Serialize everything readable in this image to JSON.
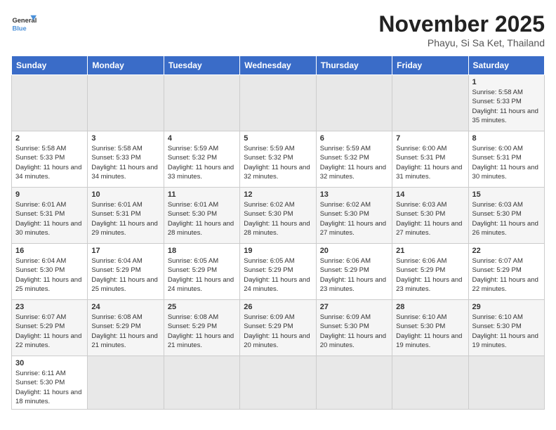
{
  "header": {
    "logo_general": "General",
    "logo_blue": "Blue",
    "month_title": "November 2025",
    "location": "Phayu, Si Sa Ket, Thailand"
  },
  "days_of_week": [
    "Sunday",
    "Monday",
    "Tuesday",
    "Wednesday",
    "Thursday",
    "Friday",
    "Saturday"
  ],
  "weeks": [
    [
      {
        "day": "",
        "empty": true
      },
      {
        "day": "",
        "empty": true
      },
      {
        "day": "",
        "empty": true
      },
      {
        "day": "",
        "empty": true
      },
      {
        "day": "",
        "empty": true
      },
      {
        "day": "",
        "empty": true
      },
      {
        "day": "1",
        "sunrise": "5:58 AM",
        "sunset": "5:33 PM",
        "daylight": "11 hours and 35 minutes."
      }
    ],
    [
      {
        "day": "2",
        "sunrise": "5:58 AM",
        "sunset": "5:33 PM",
        "daylight": "11 hours and 34 minutes."
      },
      {
        "day": "3",
        "sunrise": "5:58 AM",
        "sunset": "5:33 PM",
        "daylight": "11 hours and 34 minutes."
      },
      {
        "day": "4",
        "sunrise": "5:59 AM",
        "sunset": "5:32 PM",
        "daylight": "11 hours and 33 minutes."
      },
      {
        "day": "5",
        "sunrise": "5:59 AM",
        "sunset": "5:32 PM",
        "daylight": "11 hours and 32 minutes."
      },
      {
        "day": "6",
        "sunrise": "5:59 AM",
        "sunset": "5:32 PM",
        "daylight": "11 hours and 32 minutes."
      },
      {
        "day": "7",
        "sunrise": "6:00 AM",
        "sunset": "5:31 PM",
        "daylight": "11 hours and 31 minutes."
      },
      {
        "day": "8",
        "sunrise": "6:00 AM",
        "sunset": "5:31 PM",
        "daylight": "11 hours and 30 minutes."
      }
    ],
    [
      {
        "day": "9",
        "sunrise": "6:01 AM",
        "sunset": "5:31 PM",
        "daylight": "11 hours and 30 minutes."
      },
      {
        "day": "10",
        "sunrise": "6:01 AM",
        "sunset": "5:31 PM",
        "daylight": "11 hours and 29 minutes."
      },
      {
        "day": "11",
        "sunrise": "6:01 AM",
        "sunset": "5:30 PM",
        "daylight": "11 hours and 28 minutes."
      },
      {
        "day": "12",
        "sunrise": "6:02 AM",
        "sunset": "5:30 PM",
        "daylight": "11 hours and 28 minutes."
      },
      {
        "day": "13",
        "sunrise": "6:02 AM",
        "sunset": "5:30 PM",
        "daylight": "11 hours and 27 minutes."
      },
      {
        "day": "14",
        "sunrise": "6:03 AM",
        "sunset": "5:30 PM",
        "daylight": "11 hours and 27 minutes."
      },
      {
        "day": "15",
        "sunrise": "6:03 AM",
        "sunset": "5:30 PM",
        "daylight": "11 hours and 26 minutes."
      }
    ],
    [
      {
        "day": "16",
        "sunrise": "6:04 AM",
        "sunset": "5:30 PM",
        "daylight": "11 hours and 25 minutes."
      },
      {
        "day": "17",
        "sunrise": "6:04 AM",
        "sunset": "5:29 PM",
        "daylight": "11 hours and 25 minutes."
      },
      {
        "day": "18",
        "sunrise": "6:05 AM",
        "sunset": "5:29 PM",
        "daylight": "11 hours and 24 minutes."
      },
      {
        "day": "19",
        "sunrise": "6:05 AM",
        "sunset": "5:29 PM",
        "daylight": "11 hours and 24 minutes."
      },
      {
        "day": "20",
        "sunrise": "6:06 AM",
        "sunset": "5:29 PM",
        "daylight": "11 hours and 23 minutes."
      },
      {
        "day": "21",
        "sunrise": "6:06 AM",
        "sunset": "5:29 PM",
        "daylight": "11 hours and 23 minutes."
      },
      {
        "day": "22",
        "sunrise": "6:07 AM",
        "sunset": "5:29 PM",
        "daylight": "11 hours and 22 minutes."
      }
    ],
    [
      {
        "day": "23",
        "sunrise": "6:07 AM",
        "sunset": "5:29 PM",
        "daylight": "11 hours and 22 minutes."
      },
      {
        "day": "24",
        "sunrise": "6:08 AM",
        "sunset": "5:29 PM",
        "daylight": "11 hours and 21 minutes."
      },
      {
        "day": "25",
        "sunrise": "6:08 AM",
        "sunset": "5:29 PM",
        "daylight": "11 hours and 21 minutes."
      },
      {
        "day": "26",
        "sunrise": "6:09 AM",
        "sunset": "5:29 PM",
        "daylight": "11 hours and 20 minutes."
      },
      {
        "day": "27",
        "sunrise": "6:09 AM",
        "sunset": "5:30 PM",
        "daylight": "11 hours and 20 minutes."
      },
      {
        "day": "28",
        "sunrise": "6:10 AM",
        "sunset": "5:30 PM",
        "daylight": "11 hours and 19 minutes."
      },
      {
        "day": "29",
        "sunrise": "6:10 AM",
        "sunset": "5:30 PM",
        "daylight": "11 hours and 19 minutes."
      }
    ],
    [
      {
        "day": "30",
        "sunrise": "6:11 AM",
        "sunset": "5:30 PM",
        "daylight": "11 hours and 18 minutes."
      },
      {
        "day": "",
        "empty": true
      },
      {
        "day": "",
        "empty": true
      },
      {
        "day": "",
        "empty": true
      },
      {
        "day": "",
        "empty": true
      },
      {
        "day": "",
        "empty": true
      },
      {
        "day": "",
        "empty": true
      }
    ]
  ]
}
